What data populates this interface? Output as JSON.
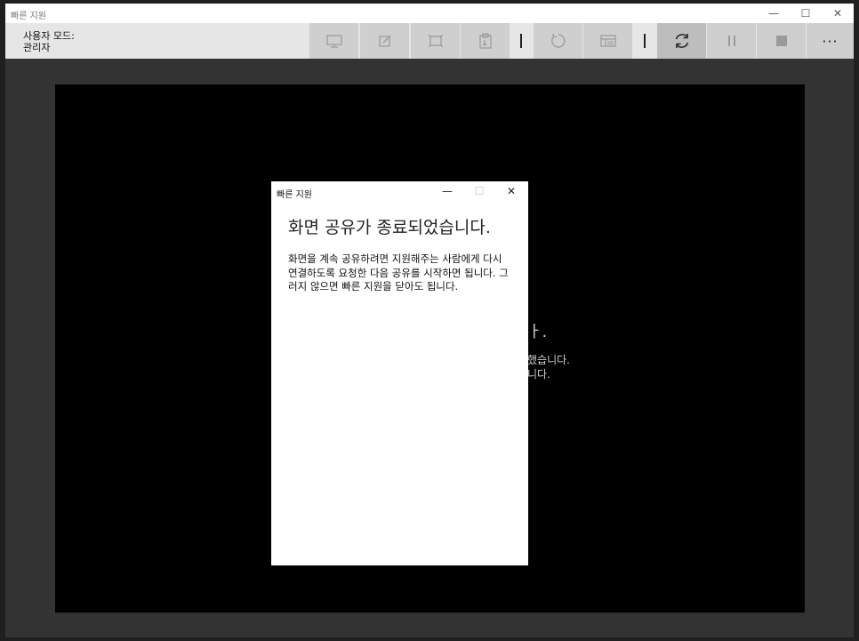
{
  "window": {
    "title": "빠른 지원",
    "controls": {
      "minimize": "—",
      "maximize": "☐",
      "close": "✕"
    }
  },
  "toolbar": {
    "mode_label": "사용자 모드:",
    "mode_value": "관리자",
    "more_label": "···",
    "buttons": [
      {
        "name": "select-monitor-icon",
        "enabled": false
      },
      {
        "name": "annotate-icon",
        "enabled": false
      },
      {
        "name": "actual-size-icon",
        "enabled": false
      },
      {
        "name": "clipboard-icon",
        "enabled": false
      },
      {
        "name": "restart-icon",
        "enabled": false
      },
      {
        "name": "task-manager-icon",
        "enabled": false
      },
      {
        "name": "reconnect-icon",
        "enabled": true
      },
      {
        "name": "pause-icon",
        "enabled": false
      },
      {
        "name": "stop-icon",
        "enabled": false
      }
    ]
  },
  "remote_background": {
    "line1": "ㅏ.",
    "line2": "했습니다.",
    "line3": "니다."
  },
  "dialog": {
    "title": "빠른 지원",
    "heading": "화면 공유가 종료되었습니다.",
    "body": "화면을 계속 공유하려면 지원해주는 사람에게 다시 연결하도록 요청한 다음 공유를 시작하면 됩니다. 그러지 않으면 빠른 지원을 닫아도 됩니다."
  },
  "colors": {
    "app_background": "#333333",
    "toolbar": "#e6e6e6",
    "toolbar_button": "#cfcfcf",
    "remote_screen": "#000000",
    "dialog": "#ffffff"
  }
}
